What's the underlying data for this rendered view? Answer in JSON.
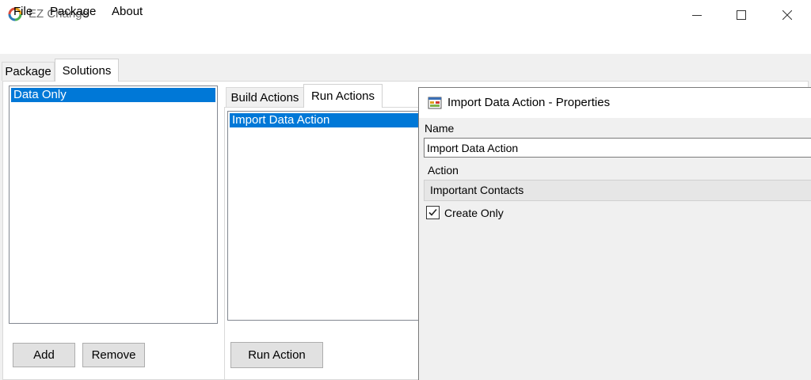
{
  "window": {
    "title": "EZ Change",
    "controls": {
      "minimize": "minimize-icon",
      "maximize": "maximize-icon",
      "close": "close-icon"
    }
  },
  "menu": {
    "items": [
      "File",
      "Package",
      "About"
    ]
  },
  "main_tabs": [
    {
      "label": "Package",
      "active": false
    },
    {
      "label": "Solutions",
      "active": true
    }
  ],
  "solutions": {
    "items": [
      {
        "label": "Data Only",
        "selected": true
      }
    ],
    "add_label": "Add",
    "remove_label": "Remove"
  },
  "action_tabs": [
    {
      "label": "Build Actions",
      "active": false
    },
    {
      "label": "Run Actions",
      "active": true
    }
  ],
  "actions": {
    "items": [
      {
        "label": "Import Data Action",
        "selected": true
      }
    ],
    "run_label": "Run Action"
  },
  "properties": {
    "title": "Import Data Action - Properties",
    "name_label": "Name",
    "name_value": "Import Data Action",
    "action_label": "Action",
    "action_value": "Important Contacts",
    "create_only_label": "Create Only",
    "create_only_checked": true
  },
  "colors": {
    "selection": "#0078d7",
    "window_bg": "#f0f0f0"
  }
}
